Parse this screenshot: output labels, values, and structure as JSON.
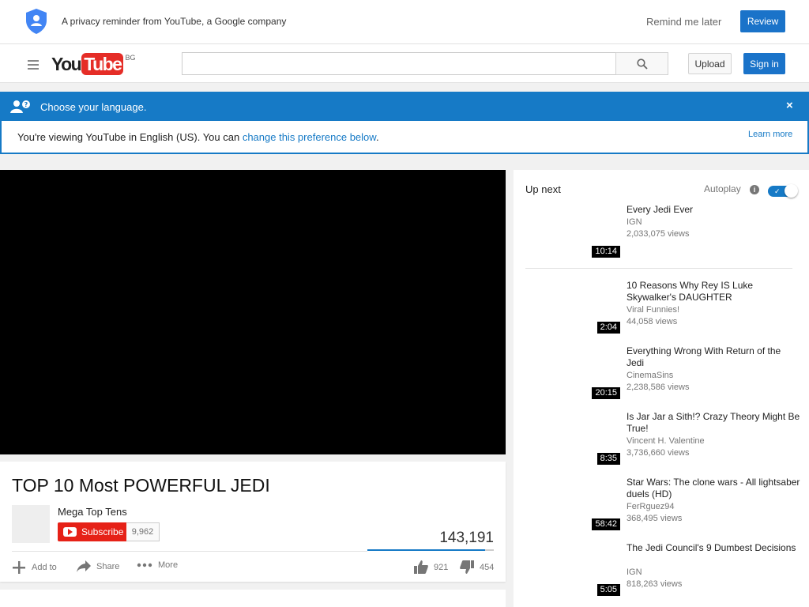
{
  "privacy": {
    "message": "A privacy reminder from YouTube, a Google company",
    "remind_later": "Remind me later",
    "review": "Review"
  },
  "masthead": {
    "logo_you": "You",
    "logo_tube": "Tube",
    "country_code": "BG",
    "search_value": "",
    "upload": "Upload",
    "signin": "Sign in"
  },
  "language": {
    "title": "Choose your language.",
    "close": "×",
    "body_prefix": "You're viewing YouTube in English (US). You can ",
    "body_link": "change this preference below",
    "body_suffix": ".",
    "learn_more": "Learn more"
  },
  "video": {
    "title": "TOP 10 Most POWERFUL JEDI",
    "channel": "Mega Top Tens",
    "subscribe": "Subscribe",
    "subscriber_count": "9,962",
    "views": "143,191",
    "like_ratio": 0.93,
    "add_to": "Add to",
    "share": "Share",
    "more": "More",
    "likes": "921",
    "dislikes": "454"
  },
  "sidebar": {
    "up_next": "Up next",
    "autoplay": "Autoplay",
    "autoplay_info": "i",
    "autoplay_on": true,
    "items": [
      {
        "title": "Every Jedi Ever",
        "channel": "IGN",
        "views": "2,033,075 views",
        "duration": "10:14"
      },
      {
        "title": "10 Reasons Why Rey IS Luke Skywalker's DAUGHTER",
        "channel": "Viral Funnies!",
        "views": "44,058 views",
        "duration": "2:04"
      },
      {
        "title": "Everything Wrong With Return of the Jedi",
        "channel": "CinemaSins",
        "views": "2,238,586 views",
        "duration": "20:15"
      },
      {
        "title": "Is Jar Jar a Sith!? Crazy Theory Might Be True!",
        "channel": "Vincent H. Valentine",
        "views": "3,736,660 views",
        "duration": "8:35"
      },
      {
        "title": "Star Wars: The clone wars - All lightsaber duels (HD)",
        "channel": "FerRguez94",
        "views": "368,495 views",
        "duration": "58:42"
      },
      {
        "title": "The Jedi Council's 9 Dumbest Decisions",
        "channel": "IGN",
        "views": "818,263 views",
        "duration": "5:05"
      }
    ]
  },
  "colors": {
    "brand_red": "#e52d27",
    "accent_blue": "#167ac6",
    "subscribe_red": "#e62117"
  }
}
